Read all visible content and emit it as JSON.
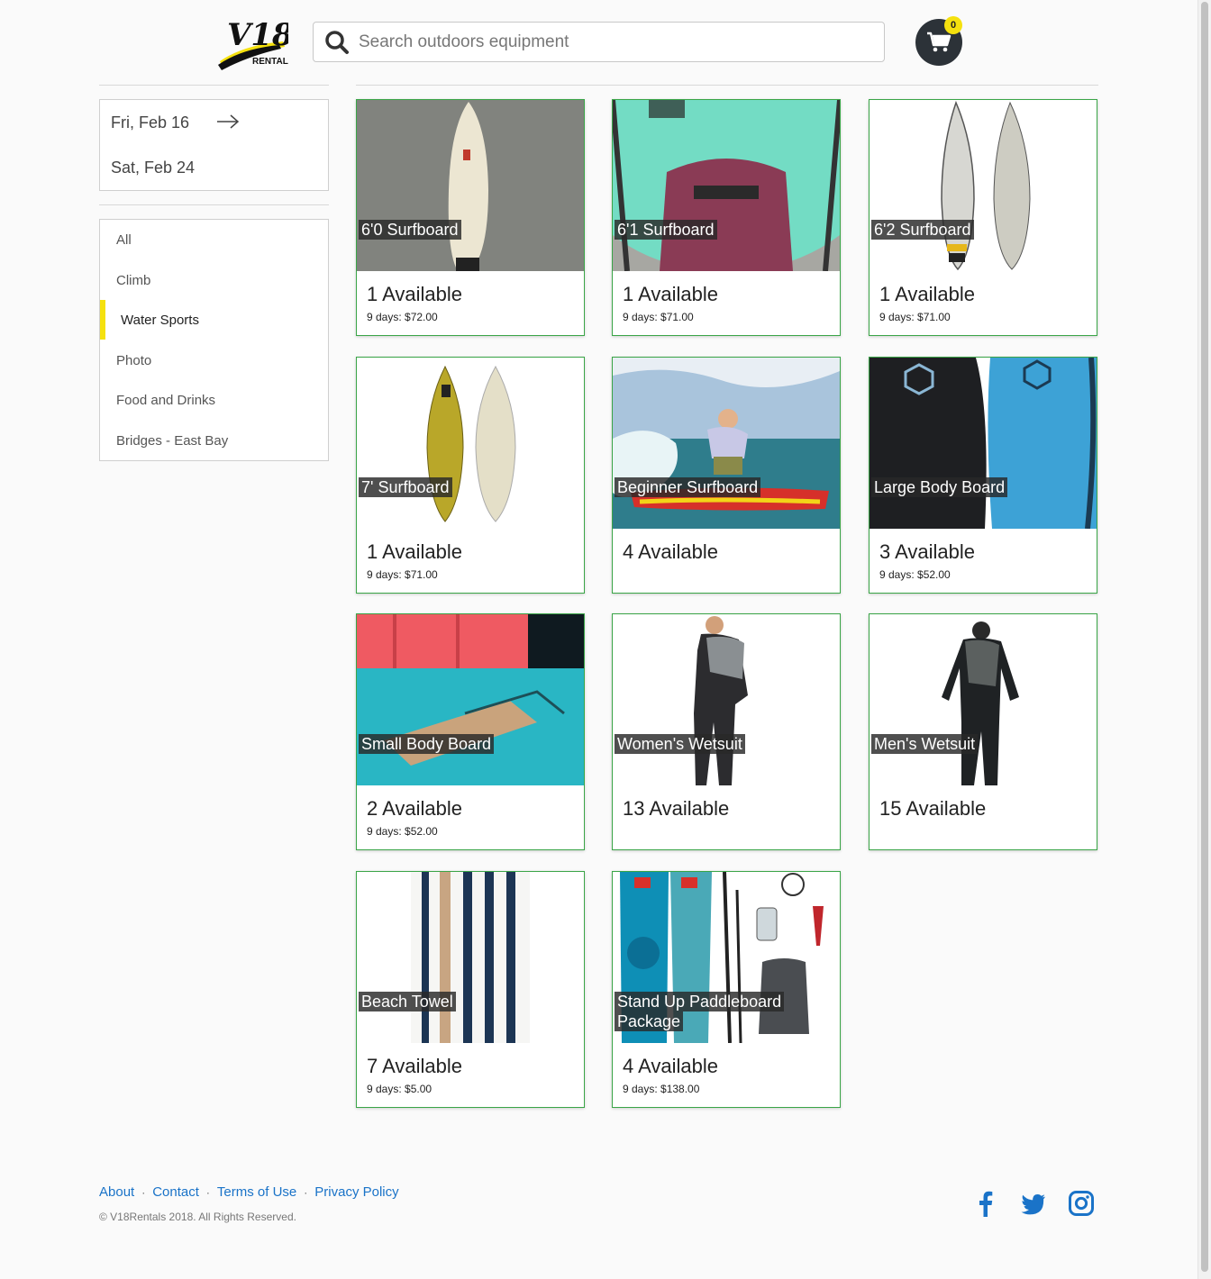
{
  "brand": {
    "logo_text": "V18",
    "logo_sub": "RENTALS"
  },
  "search": {
    "placeholder": "Search outdoors equipment",
    "value": ""
  },
  "cart": {
    "count": "0"
  },
  "dates": {
    "start": "Fri, Feb 16",
    "end": "Sat, Feb 24"
  },
  "categories": [
    {
      "label": "All"
    },
    {
      "label": "Climb"
    },
    {
      "label": "Water Sports",
      "active": true
    },
    {
      "label": "Photo"
    },
    {
      "label": "Food and Drinks"
    },
    {
      "label": "Bridges - East Bay"
    }
  ],
  "products": [
    {
      "name": "6'0 Surfboard",
      "available": "1 Available",
      "price": "9 days: $72.00"
    },
    {
      "name": "6'1 Surfboard",
      "available": "1 Available",
      "price": "9 days: $71.00"
    },
    {
      "name": "6'2 Surfboard",
      "available": "1 Available",
      "price": "9 days: $71.00"
    },
    {
      "name": "7' Surfboard",
      "available": "1 Available",
      "price": "9 days: $71.00"
    },
    {
      "name": "Beginner Surfboard",
      "available": "4 Available",
      "price": ""
    },
    {
      "name": "Large Body Board",
      "available": "3 Available",
      "price": "9 days: $52.00"
    },
    {
      "name": "Small Body Board",
      "available": "2 Available",
      "price": "9 days: $52.00"
    },
    {
      "name": "Women's Wetsuit",
      "available": "13 Available",
      "price": ""
    },
    {
      "name": "Men's Wetsuit",
      "available": "15 Available",
      "price": ""
    },
    {
      "name": "Beach Towel",
      "available": "7 Available",
      "price": "9 days: $5.00"
    },
    {
      "name": "Stand Up Paddleboard",
      "name2": "Package",
      "available": "4 Available",
      "price": "9 days: $138.00"
    }
  ],
  "footer": {
    "links": [
      "About",
      "Contact",
      "Terms of Use",
      "Privacy Policy"
    ],
    "copyright": "© V18Rentals 2018. All Rights Reserved."
  },
  "colors": {
    "accent_yellow": "#f5e10e",
    "card_border": "#3aa547",
    "link": "#1a73c8",
    "cart_bg": "#2c3238"
  }
}
